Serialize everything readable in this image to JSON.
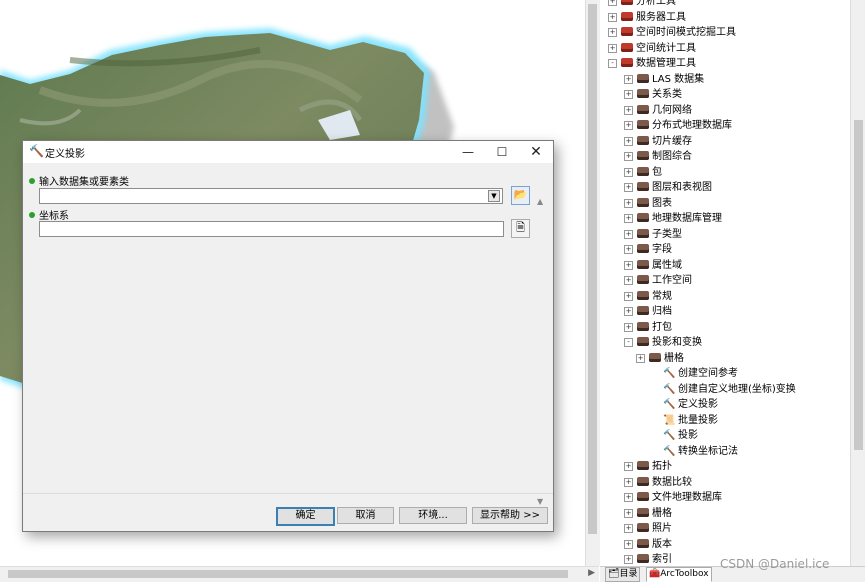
{
  "dialog": {
    "title": "定义投影",
    "field1_label": "输入数据集或要素类",
    "field1_value": "",
    "field2_label": "坐标系",
    "field2_value": "",
    "buttons": {
      "ok": "确定",
      "cancel": "取消",
      "env": "环境...",
      "help": "显示帮助 >>"
    }
  },
  "tree": {
    "items": [
      {
        "label": "分析工具",
        "kind": "toolbox",
        "expander": "+"
      },
      {
        "label": "服务器工具",
        "kind": "toolbox",
        "expander": "+"
      },
      {
        "label": "空间时间模式挖掘工具",
        "kind": "toolbox",
        "expander": "+"
      },
      {
        "label": "空间统计工具",
        "kind": "toolbox",
        "expander": "+"
      },
      {
        "label": "数据管理工具",
        "kind": "toolbox",
        "expander": "−"
      },
      {
        "label": "LAS 数据集",
        "kind": "toolset",
        "expander": "+"
      },
      {
        "label": "关系类",
        "kind": "toolset",
        "expander": "+"
      },
      {
        "label": "几何网络",
        "kind": "toolset",
        "expander": "+"
      },
      {
        "label": "分布式地理数据库",
        "kind": "toolset",
        "expander": "+"
      },
      {
        "label": "切片缓存",
        "kind": "toolset",
        "expander": "+"
      },
      {
        "label": "制图综合",
        "kind": "toolset",
        "expander": "+"
      },
      {
        "label": "包",
        "kind": "toolset",
        "expander": "+"
      },
      {
        "label": "图层和表视图",
        "kind": "toolset",
        "expander": "+"
      },
      {
        "label": "图表",
        "kind": "toolset",
        "expander": "+"
      },
      {
        "label": "地理数据库管理",
        "kind": "toolset",
        "expander": "+"
      },
      {
        "label": "子类型",
        "kind": "toolset",
        "expander": "+"
      },
      {
        "label": "字段",
        "kind": "toolset",
        "expander": "+"
      },
      {
        "label": "属性域",
        "kind": "toolset",
        "expander": "+"
      },
      {
        "label": "工作空间",
        "kind": "toolset",
        "expander": "+"
      },
      {
        "label": "常规",
        "kind": "toolset",
        "expander": "+"
      },
      {
        "label": "归档",
        "kind": "toolset",
        "expander": "+"
      },
      {
        "label": "打包",
        "kind": "toolset",
        "expander": "+"
      },
      {
        "label": "投影和变换",
        "kind": "toolset",
        "expander": "−"
      },
      {
        "label": "栅格",
        "kind": "toolset",
        "expander": "+"
      },
      {
        "label": "创建空间参考",
        "kind": "tool",
        "expander": ""
      },
      {
        "label": "创建自定义地理(坐标)变换",
        "kind": "tool",
        "expander": ""
      },
      {
        "label": "定义投影",
        "kind": "tool",
        "expander": ""
      },
      {
        "label": "批量投影",
        "kind": "script",
        "expander": ""
      },
      {
        "label": "投影",
        "kind": "tool",
        "expander": ""
      },
      {
        "label": "转换坐标记法",
        "kind": "tool",
        "expander": ""
      },
      {
        "label": "拓扑",
        "kind": "toolset",
        "expander": "+"
      },
      {
        "label": "数据比较",
        "kind": "toolset",
        "expander": "+"
      },
      {
        "label": "文件地理数据库",
        "kind": "toolset",
        "expander": "+"
      },
      {
        "label": "栅格",
        "kind": "toolset",
        "expander": "+"
      },
      {
        "label": "照片",
        "kind": "toolset",
        "expander": "+"
      },
      {
        "label": "版本",
        "kind": "toolset",
        "expander": "+"
      },
      {
        "label": "索引",
        "kind": "toolset",
        "expander": "+"
      }
    ]
  },
  "tabs": {
    "catalog": "目录",
    "arctoolbox": "ArcToolbox"
  },
  "watermark": "CSDN @Daniel.ice",
  "colors": {
    "required_dot": "#2ca02c",
    "toolbox": "#c0392b",
    "default_button_border": "#3c7fb1"
  }
}
